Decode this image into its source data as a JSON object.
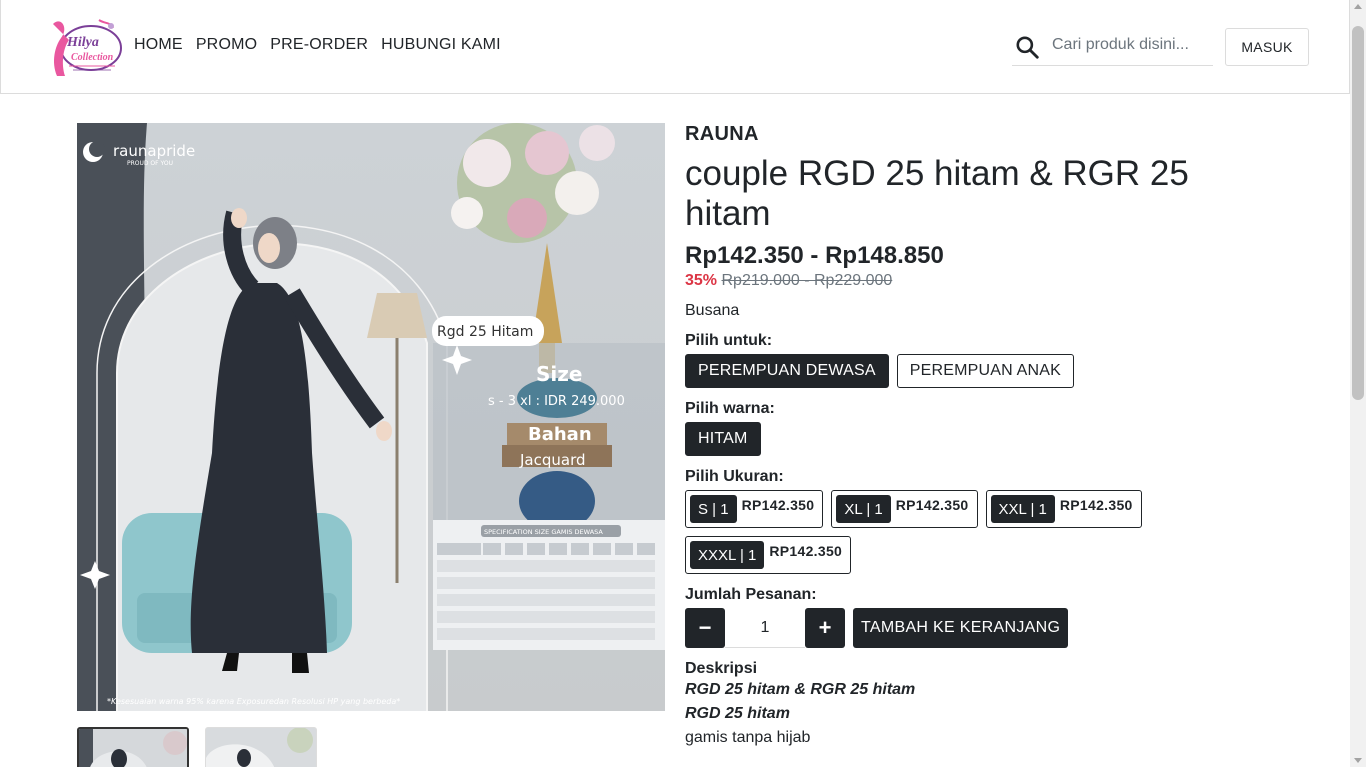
{
  "header": {
    "nav": [
      "HOME",
      "PROMO",
      "PRE-ORDER",
      "HUBUNGI KAMI"
    ],
    "search_placeholder": "Cari produk disini...",
    "login_label": "MASUK"
  },
  "logo": {
    "top_text": "Hilya",
    "bottom_text": "Collection"
  },
  "image": {
    "brand_text": "raunapride",
    "brand_tagline": "PROUD OF YOU",
    "tag": "Rgd 25 Hitam",
    "size_heading": "Size",
    "size_text": "s - 3 xl : IDR 249.000",
    "material_heading": "Bahan",
    "material_text": "Jacquard",
    "table_title": "SPECIFICATION SIZE GAMIS DEWASA",
    "footer_note": "*Kesesuaian warna 95% karena Exposuredan Resolusi HP yang berbeda*"
  },
  "product": {
    "brand": "RAUNA",
    "title": "couple RGD 25 hitam & RGR 25 hitam",
    "price_range": "Rp142.350 - Rp148.850",
    "discount": "35%",
    "old_price": "Rp219.000 - Rp229.000",
    "category": "Busana",
    "for_label": "Pilih untuk:",
    "for_options": [
      "PEREMPUAN DEWASA",
      "PEREMPUAN ANAK"
    ],
    "color_label": "Pilih warna:",
    "color_options": [
      "HITAM"
    ],
    "size_label": "Pilih Ukuran:",
    "sizes": [
      {
        "badge": "S | 1",
        "price": "RP142.350"
      },
      {
        "badge": "XL | 1",
        "price": "RP142.350"
      },
      {
        "badge": "XXL | 1",
        "price": "RP142.350"
      },
      {
        "badge": "XXXL | 1",
        "price": "RP142.350"
      }
    ],
    "qty_label": "Jumlah Pesanan:",
    "qty_minus": "−",
    "qty_value": "1",
    "qty_plus": "+",
    "add_to_cart": "TAMBAH KE KERANJANG",
    "desc_label": "Deskripsi",
    "desc_lines": [
      "RGD 25 hitam & RGR 25 hitam",
      "RGD 25 hitam",
      "gamis tanpa hijab"
    ]
  },
  "colors": {
    "dark": "#212529",
    "discount": "#dc3545",
    "logo_pink": "#e9579f",
    "logo_purple": "#7b3f98"
  }
}
